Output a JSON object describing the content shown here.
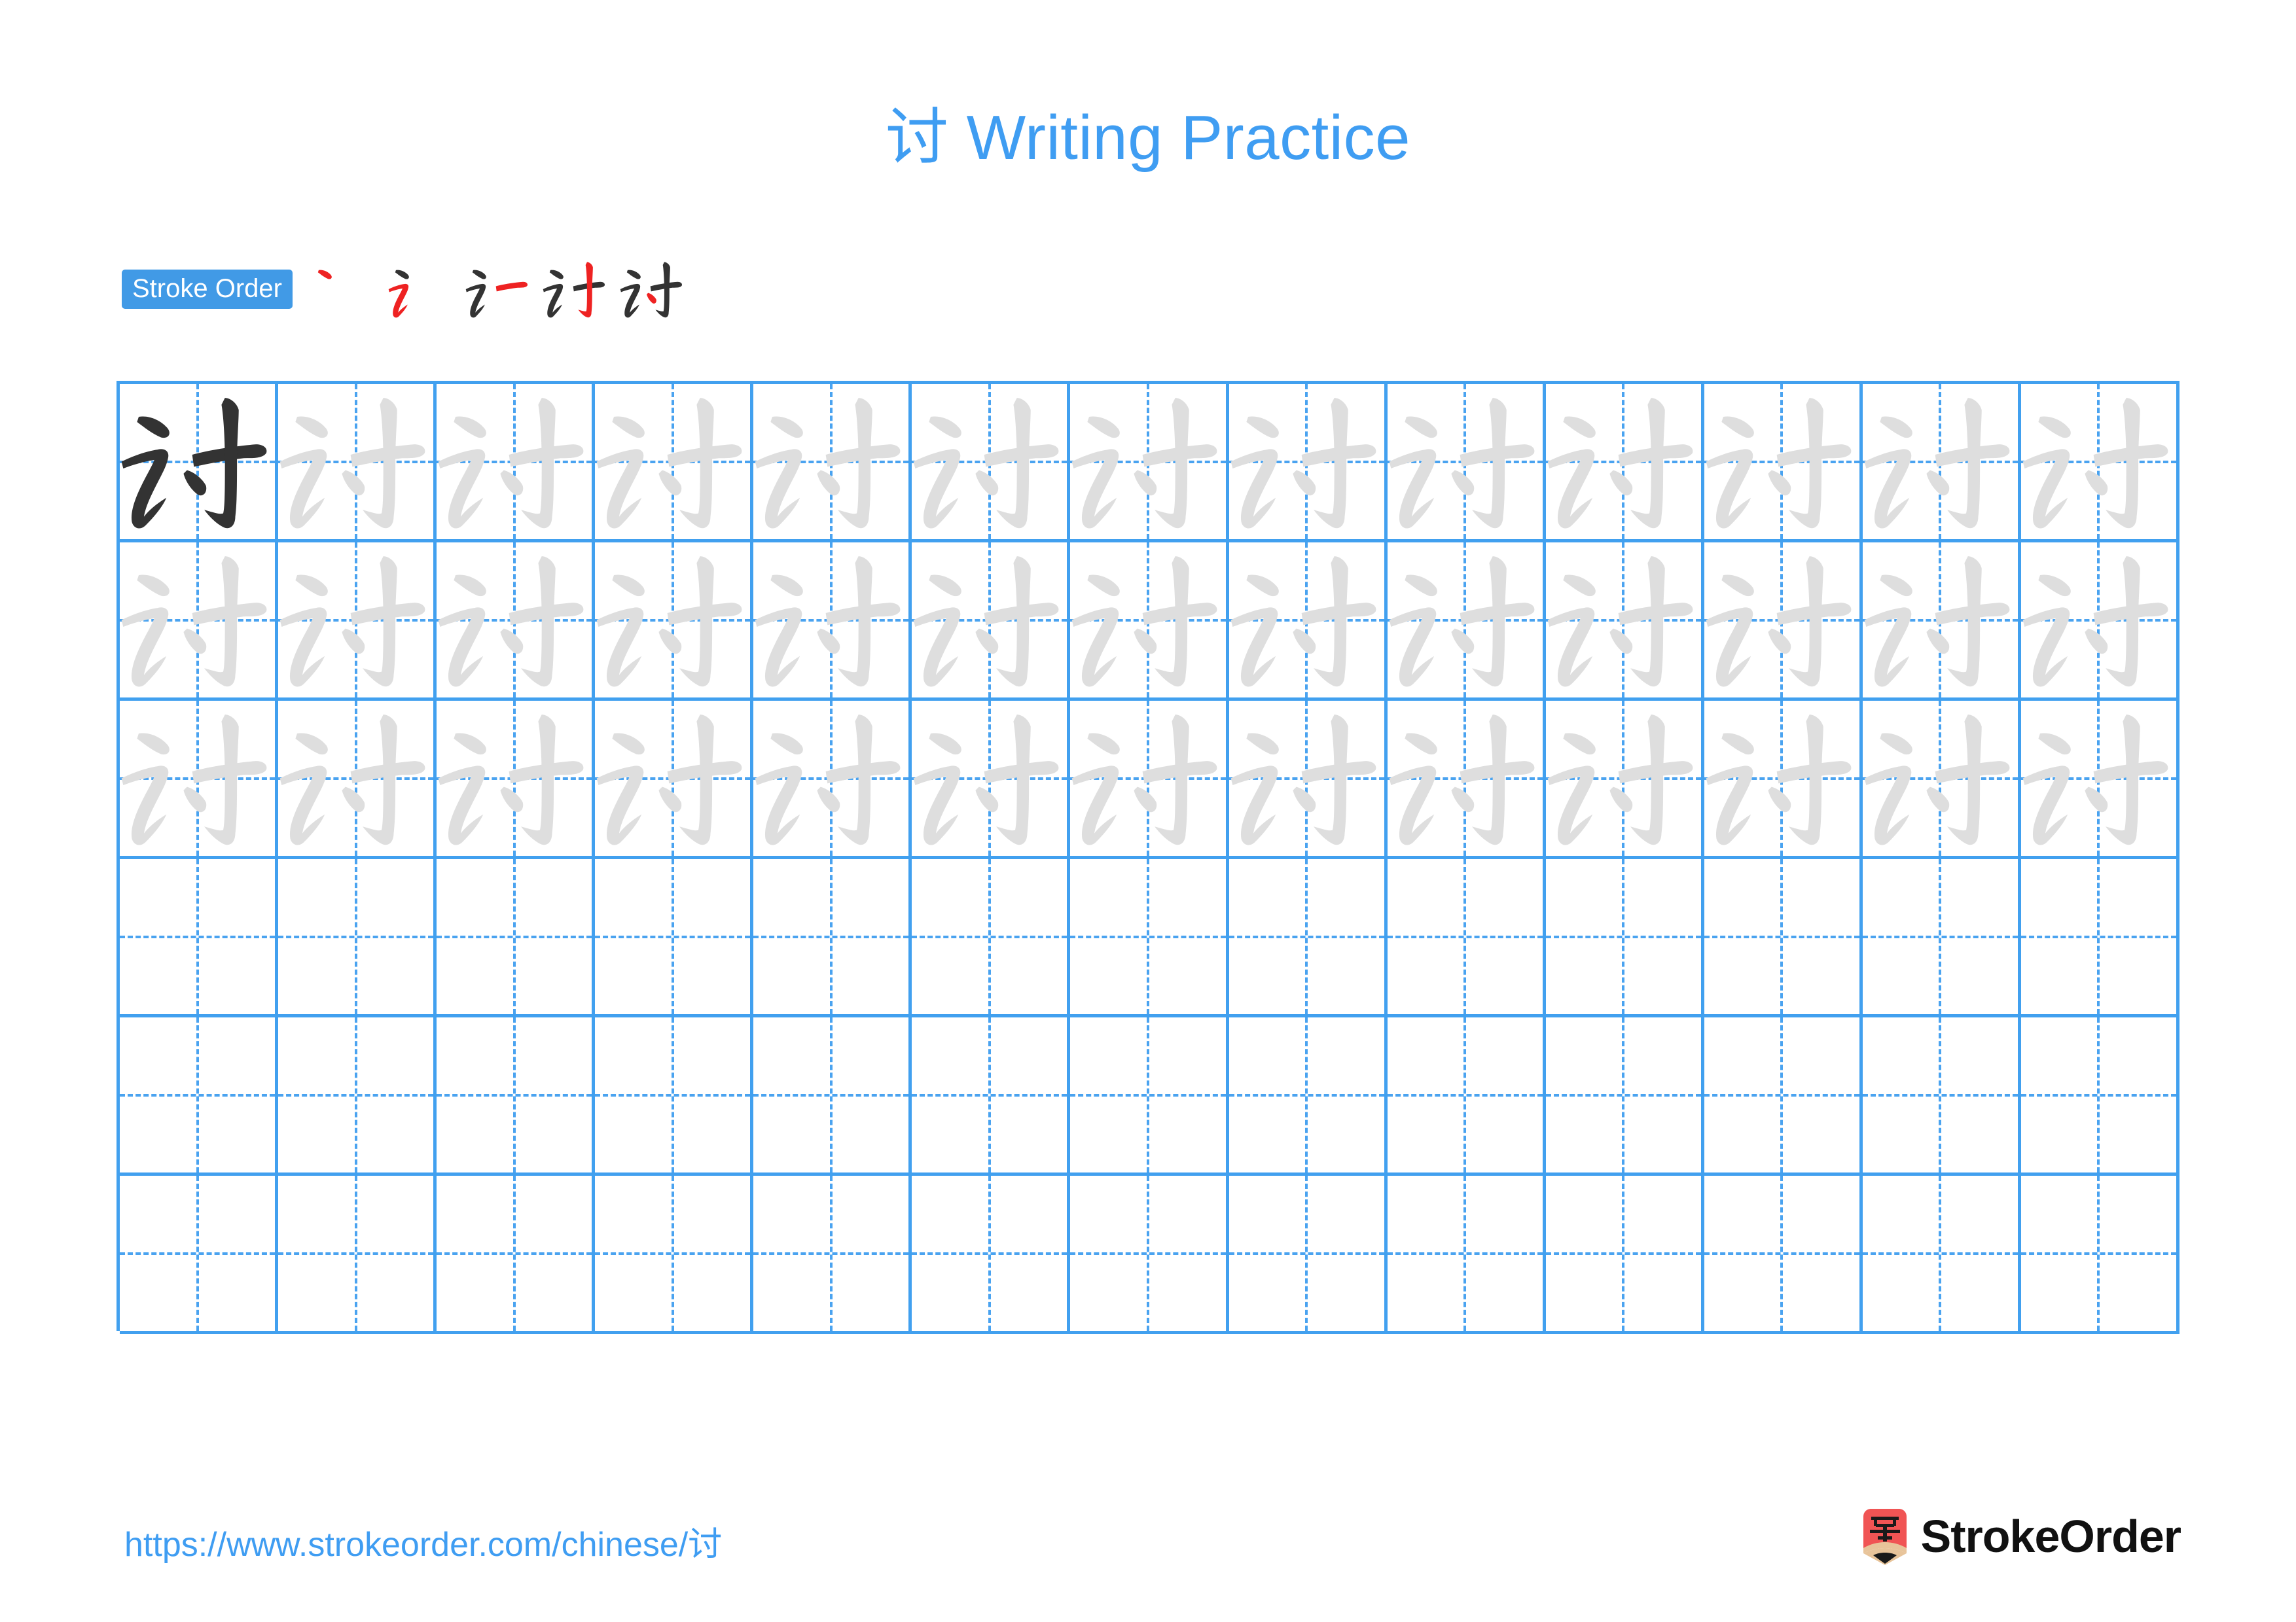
{
  "page": {
    "character": "讨",
    "title": "讨 Writing Practice",
    "title_suffix": "Writing Practice",
    "accent_blue": "#3f9df2",
    "badge_blue": "#419ae6",
    "grid_blue": "#41a0ef",
    "guide_blue": "#4aa3f0",
    "ink_dark": "#333333",
    "trace_gray": "#dedede",
    "highlight_red": "#ee2222"
  },
  "stroke_order": {
    "badge_label": "Stroke Order",
    "total_strokes": 5,
    "steps": [
      {
        "index": 1,
        "new_stroke": "丶",
        "cumulative": "丶"
      },
      {
        "index": 2,
        "new_stroke": "乛",
        "cumulative": "讠"
      },
      {
        "index": 3,
        "new_stroke": "一",
        "cumulative": "讠一"
      },
      {
        "index": 4,
        "new_stroke": "亅",
        "cumulative": "讨(4)"
      },
      {
        "index": 5,
        "new_stroke": "丶",
        "cumulative": "讨"
      }
    ]
  },
  "grid": {
    "columns": 13,
    "rows": 6,
    "cells": [
      [
        "ink",
        "trace",
        "trace",
        "trace",
        "trace",
        "trace",
        "trace",
        "trace",
        "trace",
        "trace",
        "trace",
        "trace",
        "trace"
      ],
      [
        "trace",
        "trace",
        "trace",
        "trace",
        "trace",
        "trace",
        "trace",
        "trace",
        "trace",
        "trace",
        "trace",
        "trace",
        "trace"
      ],
      [
        "trace",
        "trace",
        "trace",
        "trace",
        "trace",
        "trace",
        "trace",
        "trace",
        "trace",
        "trace",
        "trace",
        "trace",
        "trace"
      ],
      [
        "empty",
        "empty",
        "empty",
        "empty",
        "empty",
        "empty",
        "empty",
        "empty",
        "empty",
        "empty",
        "empty",
        "empty",
        "empty"
      ],
      [
        "empty",
        "empty",
        "empty",
        "empty",
        "empty",
        "empty",
        "empty",
        "empty",
        "empty",
        "empty",
        "empty",
        "empty",
        "empty"
      ],
      [
        "empty",
        "empty",
        "empty",
        "empty",
        "empty",
        "empty",
        "empty",
        "empty",
        "empty",
        "empty",
        "empty",
        "empty",
        "empty"
      ]
    ]
  },
  "footer": {
    "url": "https://www.strokeorder.com/chinese/讨",
    "brand_name": "StrokeOrder",
    "logo_character": "字",
    "logo_body_color": "#f05454",
    "logo_tip_color": "#e8c49a",
    "logo_point_color": "#1a1a1a"
  }
}
